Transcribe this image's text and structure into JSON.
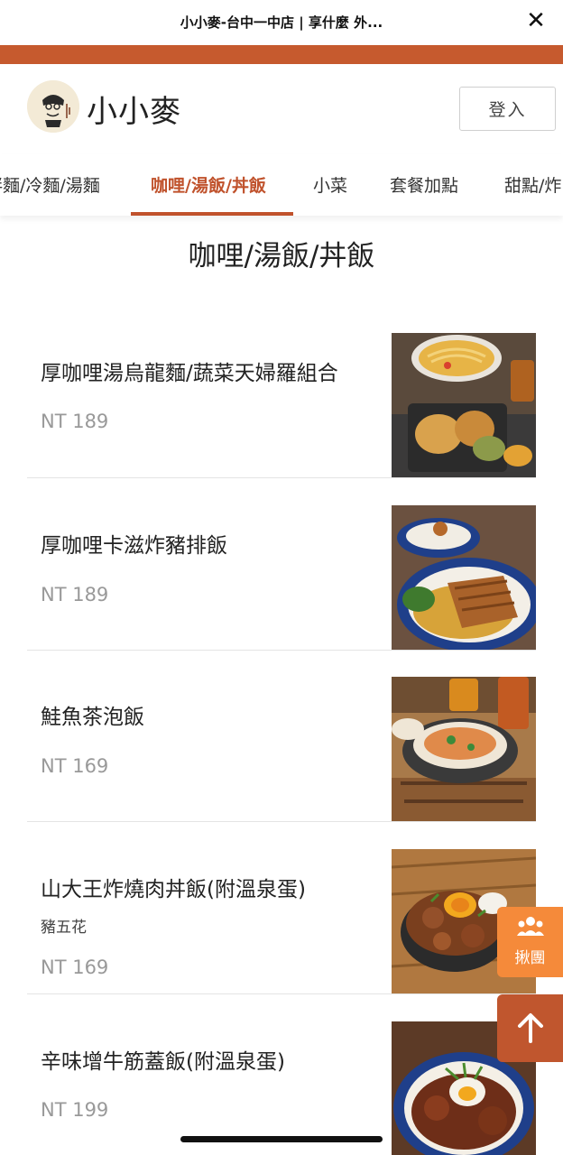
{
  "browser": {
    "title": "小小麥-台中一中店 | 享什麼 外...",
    "close_icon": "close-icon"
  },
  "colors": {
    "brand": "#c0522c",
    "stripe": "#c65a2e",
    "float_orange": "#f58a3a",
    "float_dark": "#c0562e",
    "price": "#999999"
  },
  "header": {
    "brand_name": "小小麥",
    "login_label": "登入"
  },
  "tabs": [
    {
      "label": "拌麵/冷麵/湯麵",
      "active": false
    },
    {
      "label": "咖哩/湯飯/丼飯",
      "active": true
    },
    {
      "label": "小菜",
      "active": false
    },
    {
      "label": "套餐加點",
      "active": false
    },
    {
      "label": "甜點/炸",
      "active": false
    }
  ],
  "section": {
    "title": "咖哩/湯飯/丼飯"
  },
  "items": [
    {
      "name": "厚咖哩湯烏龍麵/蔬菜天婦羅組合",
      "desc": "",
      "price": "NT 189"
    },
    {
      "name": "厚咖哩卡滋炸豬排飯",
      "desc": "",
      "price": "NT 189"
    },
    {
      "name": "鮭魚茶泡飯",
      "desc": "",
      "price": "NT 169"
    },
    {
      "name": "山大王炸燒肉丼飯(附溫泉蛋)",
      "desc": "豬五花",
      "price": "NT 169"
    },
    {
      "name": "辛味增牛筋蓋飯(附溫泉蛋)",
      "desc": "",
      "price": "NT 199"
    }
  ],
  "float": {
    "group_label": "揪團",
    "group_icon": "people-group-icon",
    "top_icon": "arrow-up-icon"
  }
}
